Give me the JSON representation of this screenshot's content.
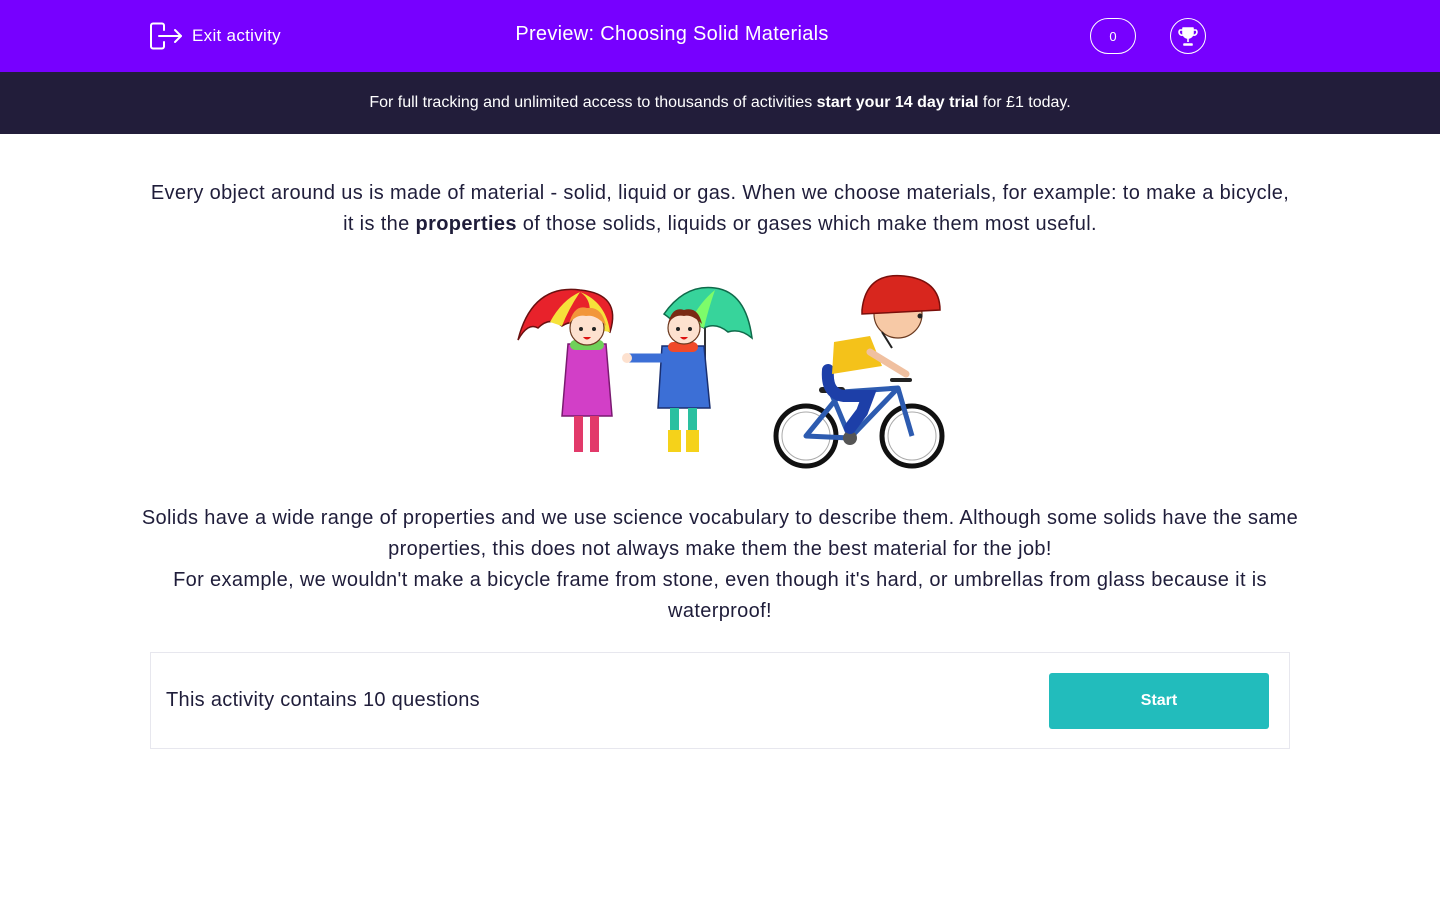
{
  "header": {
    "exit_label": "Exit activity",
    "title": "Preview: Choosing Solid Materials",
    "score": "0",
    "color": "#7700ff"
  },
  "banner": {
    "text_before": "For full tracking and unlimited access to thousands of activities ",
    "link_text": "start your 14 day trial",
    "text_after": " for £1 today."
  },
  "intro": {
    "before": "Every object around us is made of material - solid, liquid or gas. When we choose materials, for example: to make a bicycle, it is the ",
    "bold": "properties",
    "after": " of those solids, liquids or gases which make them most useful."
  },
  "illustration": {
    "icons": [
      "child-with-umbrella-icon",
      "child-with-umbrella-icon",
      "child-on-bicycle-icon"
    ]
  },
  "body": {
    "paragraph1": "Solids have a wide range of properties and we use science vocabulary to describe them. Although some solids have the same properties, this does not always make them the best material for the job!",
    "paragraph2": "For example, we wouldn't make a bicycle frame from stone, even though it's hard, or umbrellas from glass because it is waterproof!"
  },
  "activity": {
    "summary": "This activity contains 10 questions",
    "start_label": "Start",
    "button_color": "#22bcbc"
  }
}
